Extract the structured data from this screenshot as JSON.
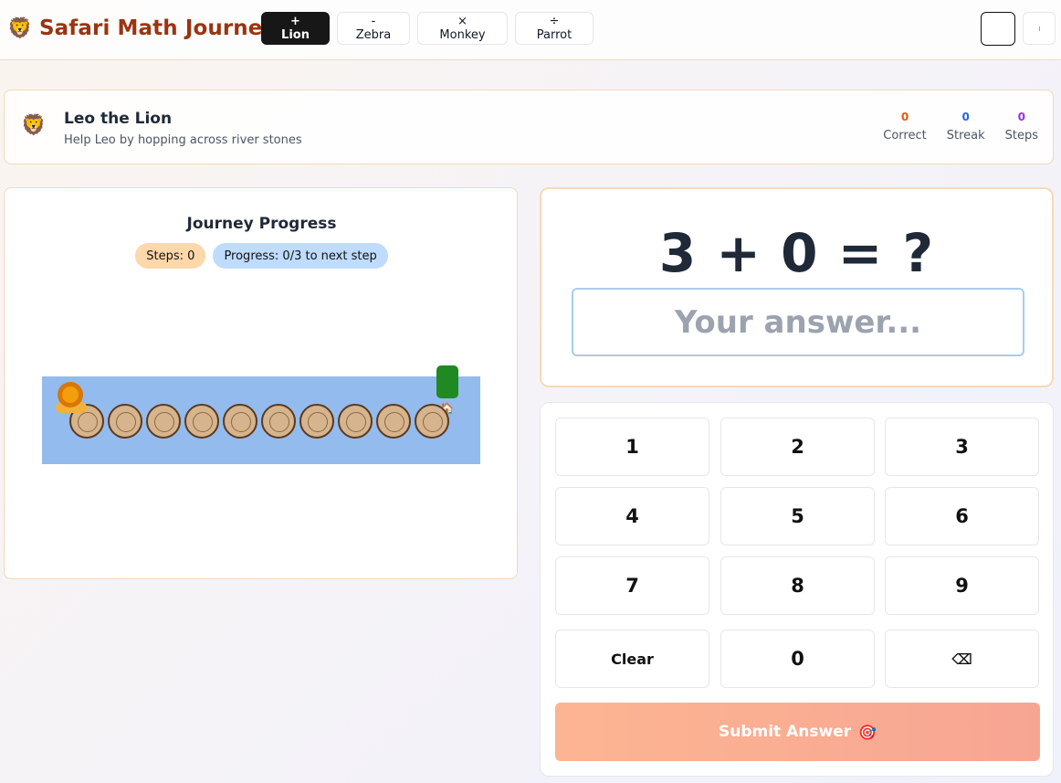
{
  "app": {
    "icon": "lion-face-icon",
    "title": "Safari Math Journey"
  },
  "tabs": [
    {
      "label": "+ Lion",
      "active": true
    },
    {
      "label": "- Zebra",
      "active": false
    },
    {
      "label": "× Monkey",
      "active": false
    },
    {
      "label": "÷ Parrot",
      "active": false
    }
  ],
  "character": {
    "avatar": "lion-face-icon",
    "name": "Leo the Lion",
    "description": "Help Leo by hopping across river stones"
  },
  "stats": [
    {
      "value": "0",
      "label": "Correct",
      "color": "#ea580c"
    },
    {
      "value": "0",
      "label": "Streak",
      "color": "#2563eb"
    },
    {
      "value": "0",
      "label": "Steps",
      "color": "#9333ea"
    }
  ],
  "journey": {
    "title": "Journey Progress",
    "steps_pill": "Steps: 0",
    "progress_pill": "Progress: 0/3 to next step",
    "stone_count": 10,
    "lion_position": 0,
    "river_color": "#93bbee",
    "goal_color": "#1f8a22"
  },
  "problem": {
    "equation": "3 + 0 = ?",
    "answer_value": "",
    "answer_placeholder": "Your answer..."
  },
  "keypad": {
    "keys": [
      "1",
      "2",
      "3",
      "4",
      "5",
      "6",
      "7",
      "8",
      "9",
      "Clear",
      "0",
      "⌫"
    ],
    "submit_label": "Submit Answer"
  },
  "colors": {
    "brand": "#9a3412",
    "active_tab": "#171717",
    "submit_start": "#fcb592",
    "submit_end": "#f7a593"
  }
}
